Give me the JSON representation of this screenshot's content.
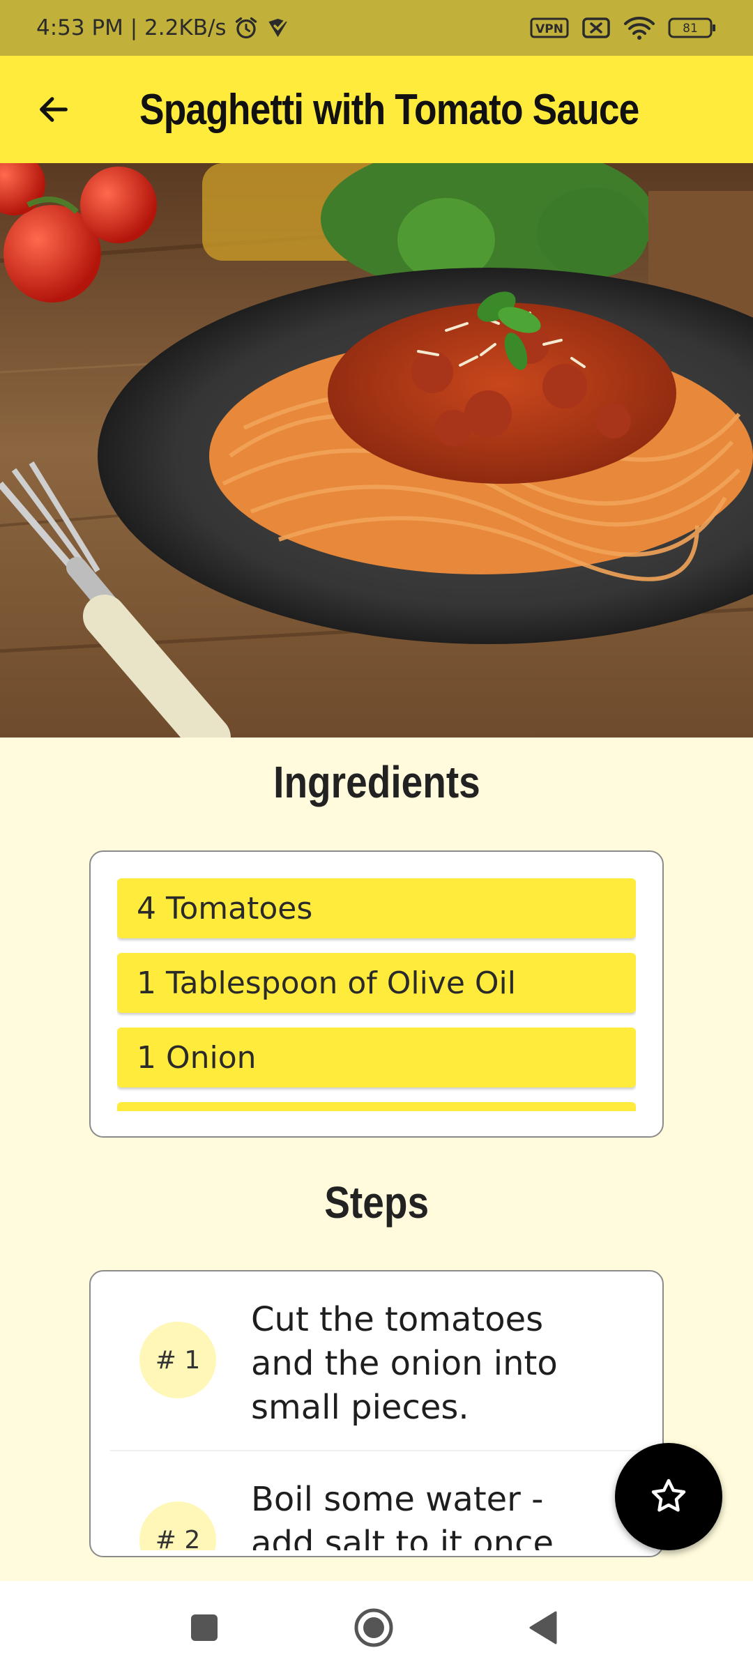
{
  "status_bar": {
    "time_and_speed": "4:53 PM | 2.2KB/s",
    "vpn_label": "VPN",
    "battery_level": "81",
    "icons": [
      "alarm-icon",
      "notification-check-icon",
      "vpn-icon",
      "sim-off-icon",
      "wifi-icon",
      "battery-icon"
    ]
  },
  "app_bar": {
    "title": "Spaghetti with Tomato Sauce",
    "back_icon": "arrow-left-icon"
  },
  "hero": {
    "image_subject": "plate-of-spaghetti-with-tomato-sauce"
  },
  "ingredients": {
    "heading": "Ingredients",
    "items": [
      {
        "label": "4 Tomatoes"
      },
      {
        "label": "1 Tablespoon of Olive Oil"
      },
      {
        "label": "1 Onion"
      },
      {
        "label": ""
      }
    ]
  },
  "steps": {
    "heading": "Steps",
    "items": [
      {
        "number": "# 1",
        "text": "Cut the tomatoes and the onion into small pieces."
      },
      {
        "number": "# 2",
        "text": "Boil some water - add salt to it once it"
      }
    ]
  },
  "fab": {
    "icon": "star-outline-icon"
  },
  "nav_bar": {
    "icons": [
      "recents-square-icon",
      "home-circle-icon",
      "back-triangle-icon"
    ]
  },
  "colors": {
    "status_bar": "#c1b13b",
    "app_bar": "#ffeb3b",
    "background": "#fffbdc",
    "ingredient_chip": "#ffeb3b",
    "step_badge": "#fff7b8",
    "fab": "#000000"
  }
}
